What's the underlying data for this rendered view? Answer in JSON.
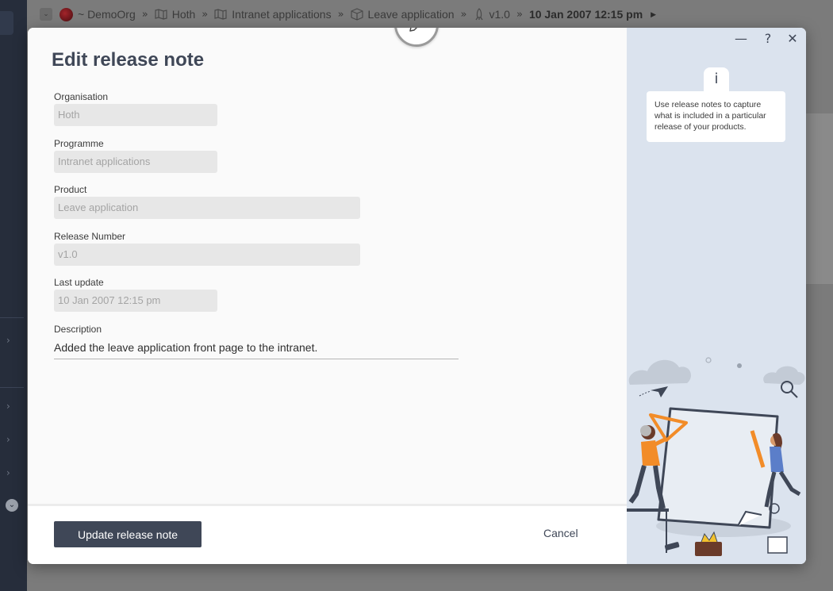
{
  "breadcrumb": {
    "org": "~ DemoOrg",
    "items": [
      "Hoth",
      "Intranet applications",
      "Leave application",
      "v1.0"
    ],
    "current": "10 Jan 2007 12:15 pm"
  },
  "modal": {
    "title": "Edit release note",
    "fields": [
      {
        "label": "Organisation",
        "value": "Hoth"
      },
      {
        "label": "Programme",
        "value": "Intranet applications"
      },
      {
        "label": "Product",
        "value": "Leave application"
      },
      {
        "label": "Release Number",
        "value": "v1.0"
      },
      {
        "label": "Last update",
        "value": "10 Jan 2007 12:15 pm"
      }
    ],
    "description": {
      "label": "Description",
      "value": "Added the leave application front page to the intranet."
    },
    "primary_button": "Update release note",
    "cancel_button": "Cancel",
    "info_icon": "i",
    "info_text": "Use release notes to capture what is included in a particular release of your products.",
    "window_controls": {
      "minimize": "—",
      "help": "?",
      "close": "✕"
    }
  },
  "colors": {
    "primary": "#3f4757",
    "side_panel": "#dbe3ee",
    "field_bg": "#e7e7e7",
    "illustration_accent": "#f28c28"
  },
  "icons": {
    "edit": "pencil-icon",
    "org": "org-orb-icon",
    "programme": "map-icon",
    "product": "box-icon",
    "release": "rocket-icon"
  }
}
